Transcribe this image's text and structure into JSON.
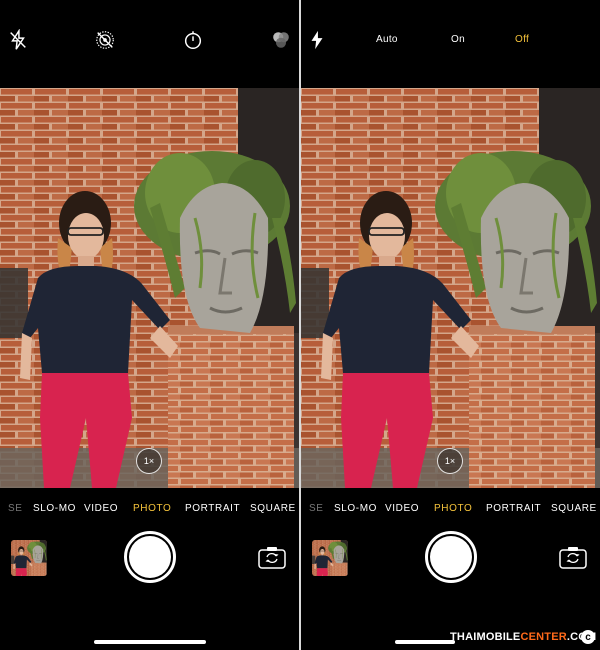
{
  "left_screen": {
    "zoom_label": "1×",
    "modes": [
      "SE",
      "SLO-MO",
      "VIDEO",
      "PHOTO",
      "PORTRAIT",
      "SQUARE"
    ],
    "active_mode": "PHOTO",
    "top_icons": [
      "flash-off-icon",
      "live-photo-off-icon",
      "timer-icon",
      "filters-icon"
    ]
  },
  "right_screen": {
    "zoom_label": "1×",
    "flash_options": [
      "Auto",
      "On",
      "Off"
    ],
    "active_flash_option": "Off",
    "modes": [
      "SE",
      "SLO-MO",
      "VIDEO",
      "PHOTO",
      "PORTRAIT",
      "SQUARE"
    ],
    "active_mode": "PHOTO"
  },
  "watermark": {
    "part1": "THAIMOBILE",
    "part2": "CENTER",
    "part3": ".COM",
    "copyright": "c"
  },
  "colors": {
    "accent_yellow": "#f5c33b",
    "watermark_accent": "#ff6a1a",
    "brick": "#b5603c",
    "mortar": "#d9a989"
  }
}
